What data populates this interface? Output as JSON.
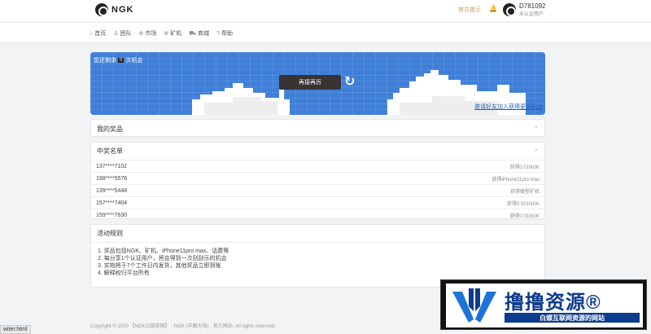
{
  "header": {
    "logo_text": "NGK",
    "official_tip": "官方提示",
    "user_id": "D781092",
    "user_status": "未认证用户"
  },
  "nav": [
    {
      "icon": "home-icon",
      "glyph": "⌂",
      "label": "首页"
    },
    {
      "icon": "team-icon",
      "glyph": "♙",
      "label": "团队"
    },
    {
      "icon": "globe-icon",
      "glyph": "⊕",
      "label": "市场"
    },
    {
      "icon": "plus-circle-icon",
      "glyph": "⊕",
      "label": "矿机"
    },
    {
      "icon": "cart-icon",
      "glyph": "⛟",
      "label": "商城"
    },
    {
      "icon": "help-icon",
      "glyph": "?",
      "label": "帮助"
    }
  ],
  "banner": {
    "chances_prefix": "您还剩余",
    "chances_count": "0",
    "chances_suffix": "次机会",
    "draw_button": "再接再厉",
    "refresh_glyph": "↻",
    "invite_link": "邀请好友加入获得更多机会"
  },
  "prizes_panel": {
    "title": "我的奖品",
    "chevron": "⌃"
  },
  "winners_panel": {
    "title": "中奖名单",
    "chevron": "⌃",
    "rows": [
      {
        "phone": "137****7102",
        "prize": "获得0.01NGK"
      },
      {
        "phone": "198****5576",
        "prize": "获得iPhone11pro max"
      },
      {
        "phone": "139****5448",
        "prize": "获得微型矿机"
      },
      {
        "phone": "157****7404",
        "prize": "获得0.001NGK"
      },
      {
        "phone": "159****7630",
        "prize": "获得0.01NGK"
      }
    ]
  },
  "rules_panel": {
    "title": "活动规则",
    "rules": [
      "1. 奖品包括NGK、矿机、iPhone11pro max、话费等",
      "2. 每分享1个认证用户，将会得到一次刮刮乐的机会",
      "3. 实物将于7个工作日内发货，其他奖品立即到账",
      "4. 解释权归平台所有"
    ]
  },
  "footer": {
    "copyright": "Copyright © 2020 【NGK公链官网】 - NGK (中国大陆) - 官方网站. All rights reserved."
  },
  "status_url": "witer.html",
  "watermark": {
    "title": "撸撸资源®",
    "subtitle": "白嫖互联网资源的网站"
  },
  "colors": {
    "banner_blue": "#3f7fd8",
    "accent_gold": "#c79a5a",
    "watermark_blue": "#0d3b8e"
  }
}
